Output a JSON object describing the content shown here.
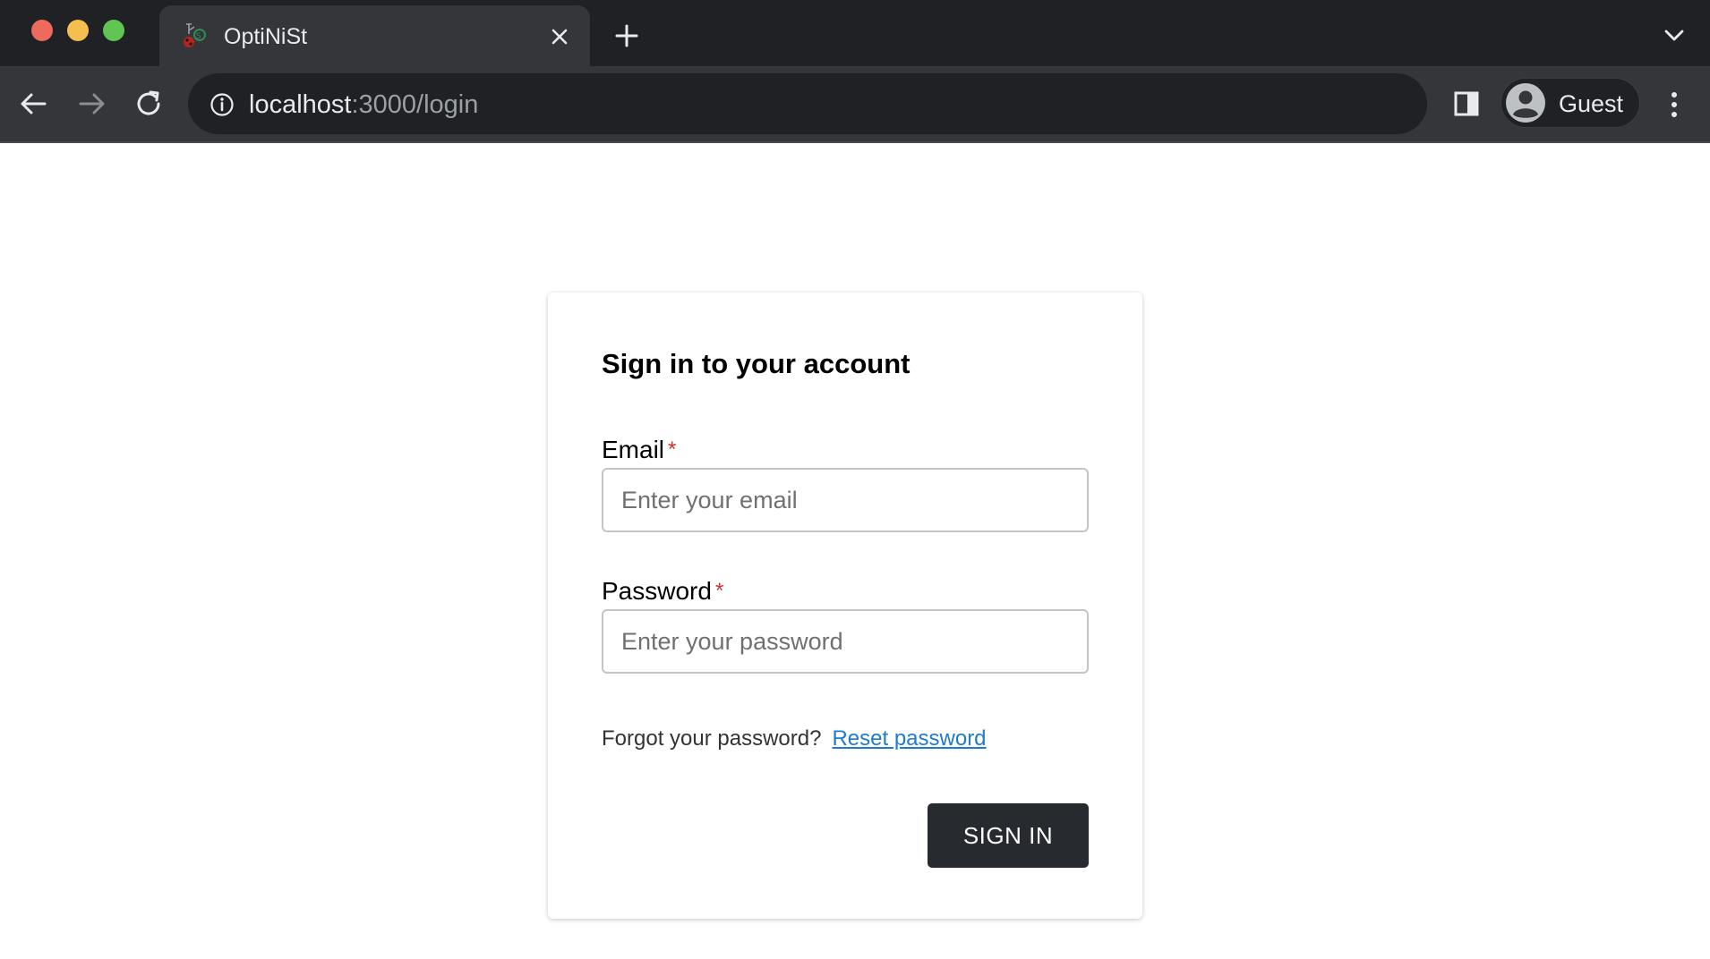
{
  "browser": {
    "tab": {
      "title": "OptiNiSt",
      "favicon": "optinist-favicon"
    },
    "omnibox": {
      "host": "localhost",
      "rest": ":3000/login"
    },
    "profile": {
      "label": "Guest"
    },
    "icons": {
      "close": "close-icon",
      "new_tab": "plus-icon",
      "tab_menu": "chevron-down-icon",
      "back": "arrow-left-icon",
      "forward": "arrow-right-icon",
      "reload": "reload-icon",
      "info": "info-icon",
      "side_panel": "side-panel-icon",
      "avatar": "person-icon",
      "menu": "kebab-menu-icon"
    }
  },
  "login": {
    "title": "Sign in to your account",
    "email": {
      "label": "Email",
      "required_mark": "*",
      "placeholder": "Enter your email",
      "value": ""
    },
    "password": {
      "label": "Password",
      "required_mark": "*",
      "placeholder": "Enter your password",
      "value": ""
    },
    "forgot_text": "Forgot your password?",
    "reset_link": "Reset password",
    "submit_label": "SIGN IN"
  },
  "colors": {
    "chrome_dark": "#202124",
    "chrome_toolbar": "#35363a",
    "required": "#d32f2f",
    "link": "#1f7ad1",
    "button_bg": "#272b2f"
  }
}
